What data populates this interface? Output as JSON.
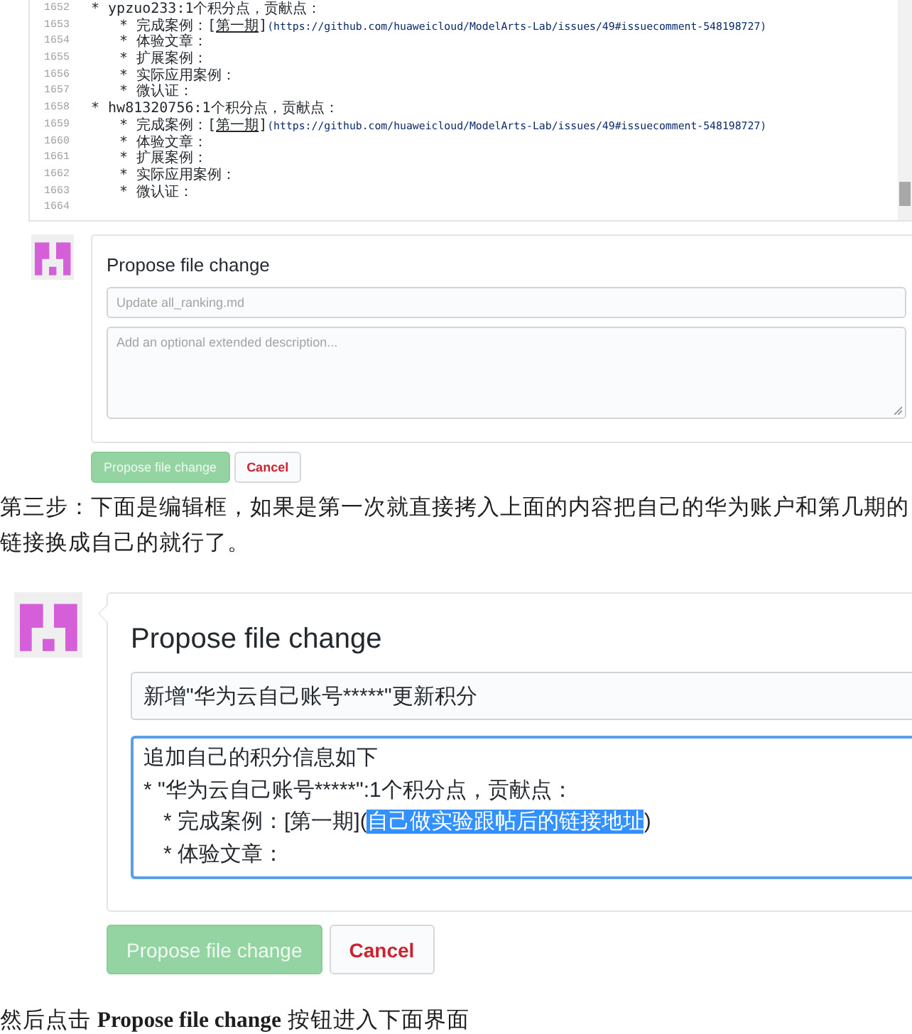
{
  "editor": {
    "lines": [
      {
        "number": "1652",
        "text": "* ypzuo233:1个积分点，贡献点：",
        "children": [
          {
            "number": "1653",
            "segments": [
              {
                "kind": "plain",
                "text": "* 完成案例：["
              },
              {
                "kind": "link",
                "text": "第一期"
              },
              {
                "kind": "plain",
                "text": "]"
              },
              {
                "kind": "url",
                "text": "(https://github.com/huaweicloud/ModelArts-Lab/issues/49#issuecomment-548198727)"
              }
            ]
          },
          {
            "number": "1654",
            "text": "* 体验文章："
          },
          {
            "number": "1655",
            "text": "* 扩展案例："
          },
          {
            "number": "1656",
            "text": "* 实际应用案例："
          },
          {
            "number": "1657",
            "text": "* 微认证："
          }
        ]
      },
      {
        "number": "1658",
        "text": "* hw81320756:1个积分点，贡献点：",
        "children": [
          {
            "number": "1659",
            "segments": [
              {
                "kind": "plain",
                "text": "* 完成案例：["
              },
              {
                "kind": "link",
                "text": "第一期"
              },
              {
                "kind": "plain",
                "text": "]"
              },
              {
                "kind": "url",
                "text": "(https://github.com/huaweicloud/ModelArts-Lab/issues/49#issuecomment-548198727)"
              }
            ]
          },
          {
            "number": "1660",
            "text": "* 体验文章："
          },
          {
            "number": "1661",
            "text": "* 扩展案例："
          },
          {
            "number": "1662",
            "text": "* 实际应用案例："
          },
          {
            "number": "1663",
            "text": "* 微认证："
          }
        ]
      },
      {
        "number": "1664"
      }
    ]
  },
  "compact_form": {
    "title": "Propose file change",
    "summary": {
      "placeholder": "Update all_ranking.md"
    },
    "description": {
      "focused": false,
      "placeholder": "Add an optional extended description..."
    },
    "buttons": [
      {
        "kind": "primary",
        "label": "Propose file change",
        "disabled": true
      },
      {
        "kind": "danger",
        "label": "Cancel",
        "disabled": false
      }
    ]
  },
  "instruction": "第三步：下面是编辑框，如果是第一次就直接拷入上面的内容把自己的华为账户和第几期的链接换成自己的就行了。",
  "expanded_form": {
    "title": "Propose file change",
    "summary": {
      "value": "新增\"华为云自己账号*****\"更新积分"
    },
    "description": {
      "focused": true,
      "lines": [
        {
          "text": "追加自己的积分信息如下"
        },
        {
          "text": "* \"华为云自己账号*****\":1个积分点，贡献点：",
          "children": [
            {
              "segments": [
                {
                  "text": "* 完成案例：[第一期](",
                  "selected": false
                },
                {
                  "text": "自己做实验跟帖后的链接地址",
                  "selected": true
                },
                {
                  "text": ")",
                  "selected": false
                }
              ]
            },
            {
              "text": "* 体验文章："
            }
          ]
        }
      ]
    },
    "buttons": [
      {
        "kind": "primary",
        "label": "Propose file change",
        "disabled": true
      },
      {
        "kind": "danger",
        "label": "Cancel",
        "disabled": false
      }
    ]
  },
  "closing_note": "然后点击 **Propose file change** 按钮进入下面界面"
}
